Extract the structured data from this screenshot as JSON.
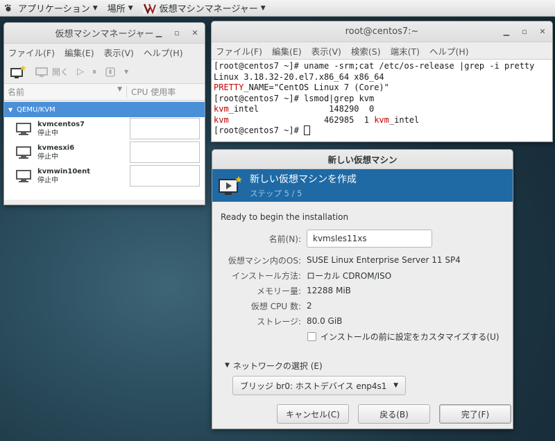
{
  "top_panel": {
    "applications_label": "アプリケーション",
    "places_label": "場所",
    "app_label": "仮想マシンマネージャー"
  },
  "vmm_window": {
    "title": "仮想マシンマネージャー",
    "menu": [
      "ファイル(F)",
      "編集(E)",
      "表示(V)",
      "ヘルプ(H)"
    ],
    "toolbar": {
      "open_label": "開く"
    },
    "columns": {
      "name": "名前",
      "cpu": "CPU 使用率"
    },
    "group": "QEMU/KVM",
    "vms": [
      {
        "name": "kvmcentos7",
        "status": "停止中"
      },
      {
        "name": "kvmesxi6",
        "status": "停止中"
      },
      {
        "name": "kvmwin10ent",
        "status": "停止中"
      }
    ]
  },
  "terminal": {
    "title": "root@centos7:~",
    "menu": [
      "ファイル(F)",
      "編集(E)",
      "表示(V)",
      "検索(S)",
      "端末(T)",
      "ヘルプ(H)"
    ],
    "lines": {
      "l1": "[root@centos7 ~]# uname -srm;cat /etc/os-release |grep -i pretty",
      "l2": "Linux 3.18.32-20.el7.x86_64 x86_64",
      "l3_red": "PRETTY",
      "l3_rest": "_NAME=\"CentOS Linux 7 (Core)\"",
      "l4": "[root@centos7 ~]# lsmod|grep kvm",
      "l5_red": "kvm",
      "l5_rest": "_intel              148290  0",
      "l6_red": "kvm",
      "l6_mid": "                   462985  1 ",
      "l6_red2": "kvm",
      "l6_rest": "_intel",
      "l7": "[root@centos7 ~]# "
    }
  },
  "dialog": {
    "title": "新しい仮想マシン",
    "banner_title": "新しい仮想マシンを作成",
    "banner_step": "ステップ 5 / 5",
    "ready_text": "Ready to begin the installation",
    "name_label": "名前(N):",
    "name_value": "kvmsles11xs",
    "os_label": "仮想マシン内のOS:",
    "os_value": "SUSE Linux Enterprise Server 11 SP4",
    "install_label": "インストール方法:",
    "install_value": "ローカル CDROM/ISO",
    "memory_label": "メモリー量:",
    "memory_value": "12288 MiB",
    "cpu_label": "仮想 CPU 数:",
    "cpu_value": "2",
    "storage_label": "ストレージ:",
    "storage_value": "80.0 GiB",
    "customize_label": "インストールの前に設定をカスタマイズする(U)",
    "network_label": "ネットワークの選択 (E)",
    "network_value": "ブリッジ br0: ホストデバイス enp4s1",
    "cancel_label": "キャンセル(C)",
    "back_label": "戻る(B)",
    "finish_label": "完了(F)"
  },
  "colors": {
    "accent_blue": "#1f6aa5",
    "selection_blue": "#4a90d9",
    "terminal_red": "#c00000"
  }
}
